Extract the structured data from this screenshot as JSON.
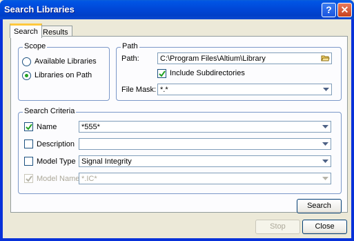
{
  "window": {
    "title": "Search Libraries",
    "help_label": "?",
    "close_label": "✕"
  },
  "tabs": [
    {
      "label": "Search",
      "active": true
    },
    {
      "label": "Results",
      "active": false
    }
  ],
  "scope": {
    "legend": "Scope",
    "options": [
      {
        "label": "Available Libraries",
        "selected": false
      },
      {
        "label": "Libraries on Path",
        "selected": true
      }
    ]
  },
  "path": {
    "legend": "Path",
    "path_label": "Path:",
    "path_value": "C:\\Program Files\\Altium\\Library",
    "include_subdirs_label": "Include Subdirectories",
    "include_subdirs_checked": true,
    "file_mask_label": "File Mask:",
    "file_mask_value": "*.*"
  },
  "criteria": {
    "legend": "Search Criteria",
    "rows": [
      {
        "label": "Name",
        "checked": true,
        "enabled": true,
        "value": "*555*"
      },
      {
        "label": "Description",
        "checked": false,
        "enabled": true,
        "value": ""
      },
      {
        "label": "Model Type",
        "checked": false,
        "enabled": true,
        "value": "Signal Integrity"
      },
      {
        "label": "Model Name",
        "checked": true,
        "enabled": false,
        "value": "*.IC*"
      }
    ]
  },
  "buttons": {
    "search": "Search",
    "stop": "Stop",
    "close": "Close"
  },
  "icons": [
    "folder-icon",
    "dropdown-arrow-icon",
    "checkmark-icon"
  ],
  "colors": {
    "title_bar": "#0054e3",
    "group_border": "#7a97c8",
    "radio_dot": "#21a121"
  }
}
